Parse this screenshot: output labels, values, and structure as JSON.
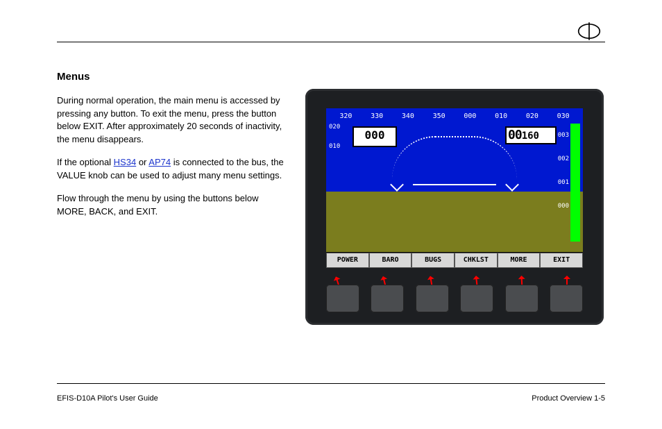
{
  "header": {
    "section_title": "Menus",
    "para1": "During normal operation, the main menu is accessed by pressing any button. To exit the menu, press the button below EXIT. After approximately 20 seconds of inactivity, the menu disappears.",
    "para2_pre": "If the optional ",
    "para2_link1": "HS34",
    "para2_mid": " or ",
    "para2_link2": "AP74",
    "para2_post": " is connected to the bus, the VALUE knob can be used to adjust many menu settings.",
    "para3": "Flow through the menu by using the buttons below MORE, BACK, and EXIT."
  },
  "display": {
    "headings": [
      "320",
      "330",
      "340",
      "350",
      "000",
      "010",
      "020",
      "030"
    ],
    "speed_box": "000",
    "alt_box_big": "00",
    "alt_box_small": "160",
    "spd_ticks": [
      "020",
      "010"
    ],
    "alt_ticks": [
      "003",
      "002",
      "001",
      "000"
    ]
  },
  "menu": {
    "items": [
      "POWER",
      "BARO",
      "BUGS",
      "CHKLST",
      "MORE",
      "EXIT"
    ]
  },
  "footer": {
    "left": "EFIS-D10A Pilot's User Guide",
    "right": "Product Overview 1-5"
  }
}
